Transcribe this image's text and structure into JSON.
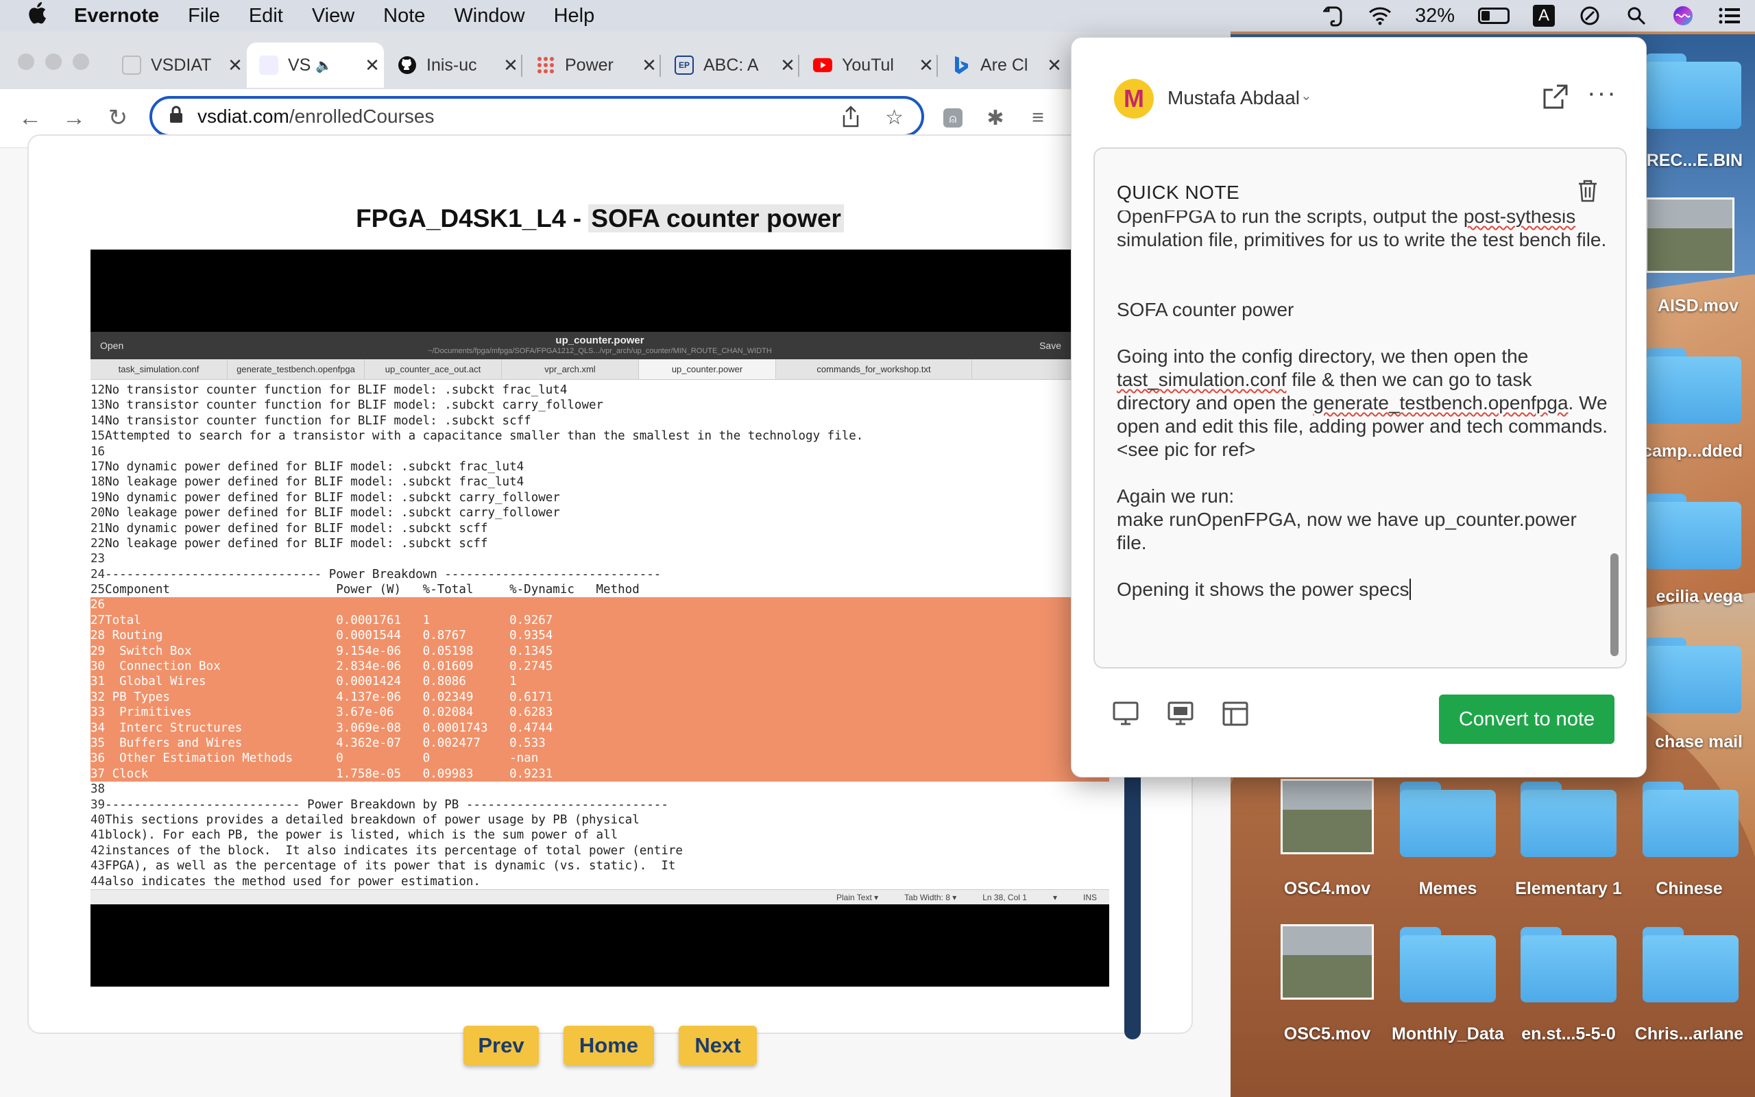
{
  "menubar": {
    "app_name": "Evernote",
    "items": [
      "File",
      "Edit",
      "View",
      "Note",
      "Window",
      "Help"
    ],
    "battery": "32%"
  },
  "browser": {
    "tabs": [
      {
        "title": "VSDIAT",
        "fav": "vsd"
      },
      {
        "title": "VS",
        "fav": "vsd",
        "active": true
      },
      {
        "title": "Inis-uc",
        "fav": "github"
      },
      {
        "title": "Power",
        "fav": "grid"
      },
      {
        "title": "ABC: A",
        "fav": "abc"
      },
      {
        "title": "YouTul",
        "fav": "youtube"
      },
      {
        "title": "Are Cl",
        "fav": "bing"
      }
    ],
    "url_domain": "vsdiat.com",
    "url_path": "/enrolledCourses"
  },
  "lesson": {
    "title_prefix": "FPGA_D4SK1_L4 - ",
    "title_highlight": "SOFA counter power",
    "buttons": {
      "prev": "Prev",
      "home": "Home",
      "next": "Next"
    }
  },
  "gedit": {
    "open": "Open",
    "title": "up_counter.power",
    "subtitle": "~/Documents/fpga/mfpga/SOFA/FPGA1212_QLS.../vpr_arch/up_counter/MIN_ROUTE_CHAN_WIDTH",
    "save": "Save",
    "tabs": [
      "task_simulation.conf",
      "generate_testbench.openfpga",
      "up_counter_ace_out.act",
      "vpr_arch.xml",
      "up_counter.power",
      "commands_for_workshop.txt"
    ],
    "lines": [
      {
        "n": "12",
        "t": "No transistor counter function for BLIF model: .subckt frac_lut4"
      },
      {
        "n": "13",
        "t": "No transistor counter function for BLIF model: .subckt carry_follower"
      },
      {
        "n": "14",
        "t": "No transistor counter function for BLIF model: .subckt scff"
      },
      {
        "n": "15",
        "t": "Attempted to search for a transistor with a capacitance smaller than the smallest in the technology file."
      },
      {
        "n": "16",
        "t": ""
      },
      {
        "n": "17",
        "t": "No dynamic power defined for BLIF model: .subckt frac_lut4"
      },
      {
        "n": "18",
        "t": "No leakage power defined for BLIF model: .subckt frac_lut4"
      },
      {
        "n": "19",
        "t": "No dynamic power defined for BLIF model: .subckt carry_follower"
      },
      {
        "n": "20",
        "t": "No leakage power defined for BLIF model: .subckt carry_follower"
      },
      {
        "n": "21",
        "t": "No dynamic power defined for BLIF model: .subckt scff"
      },
      {
        "n": "22",
        "t": "No leakage power defined for BLIF model: .subckt scff"
      },
      {
        "n": "23",
        "t": ""
      },
      {
        "n": "24",
        "t": "------------------------------ Power Breakdown ------------------------------"
      },
      {
        "n": "25",
        "t": "Component                       Power (W)   %-Total     %-Dynamic   Method"
      },
      {
        "n": "26",
        "t": "",
        "sel": true
      },
      {
        "n": "27",
        "t": "Total                           0.0001761   1           0.9267",
        "sel": true
      },
      {
        "n": "28",
        "t": " Routing                        0.0001544   0.8767      0.9354",
        "sel": true
      },
      {
        "n": "29",
        "t": "  Switch Box                    9.154e-06   0.05198     0.1345",
        "sel": true
      },
      {
        "n": "30",
        "t": "  Connection Box                2.834e-06   0.01609     0.2745",
        "sel": true
      },
      {
        "n": "31",
        "t": "  Global Wires                  0.0001424   0.8086      1",
        "sel": true
      },
      {
        "n": "32",
        "t": " PB Types                       4.137e-06   0.02349     0.6171",
        "sel": true
      },
      {
        "n": "33",
        "t": "  Primitives                    3.67e-06    0.02084     0.6283",
        "sel": true
      },
      {
        "n": "34",
        "t": "  Interc Structures             3.069e-08   0.0001743   0.4744",
        "sel": true
      },
      {
        "n": "35",
        "t": "  Buffers and Wires             4.362e-07   0.002477    0.533",
        "sel": true
      },
      {
        "n": "36",
        "t": "  Other Estimation Methods      0           0           -nan",
        "sel": true
      },
      {
        "n": "37",
        "t": " Clock                          1.758e-05   0.09983     0.9231",
        "sel": true
      },
      {
        "n": "38",
        "t": ""
      },
      {
        "n": "39",
        "t": "--------------------------- Power Breakdown by PB ----------------------------"
      },
      {
        "n": "40",
        "t": "This sections provides a detailed breakdown of power usage by PB (physical"
      },
      {
        "n": "41",
        "t": "block). For each PB, the power is listed, which is the sum power of all"
      },
      {
        "n": "42",
        "t": "instances of the block.  It also indicates its percentage of total power (entire"
      },
      {
        "n": "43",
        "t": "FPGA), as well as the percentage of its power that is dynamic (vs. static).  It"
      },
      {
        "n": "44",
        "t": "also indicates the method used for power estimation."
      }
    ],
    "status": [
      "Plain Text ▾",
      "Tab Width: 8 ▾",
      "Ln 38, Col 1",
      "▾",
      "INS"
    ]
  },
  "desktop": {
    "items": [
      {
        "label": "REC...E.BIN",
        "kind": "partial"
      },
      {
        "label": "AISD.mov",
        "kind": "partial"
      },
      {
        "label": "camp...dded",
        "kind": "partial"
      },
      {
        "label": "ecilia vega",
        "kind": "partial"
      },
      {
        "label": "chase mail",
        "kind": "partial"
      },
      {
        "label": "OSC4.mov",
        "kind": "video"
      },
      {
        "label": "Memes",
        "kind": "folder"
      },
      {
        "label": "Elementary 1",
        "kind": "folder"
      },
      {
        "label": "Chinese",
        "kind": "folder"
      },
      {
        "label": "OSC5.mov",
        "kind": "video"
      },
      {
        "label": "Monthly_Data",
        "kind": "folder"
      },
      {
        "label": "en.st...5-5-0",
        "kind": "folder"
      },
      {
        "label": "Chris...arlane",
        "kind": "folder"
      }
    ]
  },
  "evernote": {
    "user": "Mustafa Abdaal",
    "avatar_letter": "M",
    "note_title": "QUICK NOTE",
    "body": {
      "p1": "OpenFPGA to run the scripts, output the ",
      "p1_sq": "post-sythesis",
      "p1_rest": " simulation file, primitives for us to write the test bench file.",
      "p2": "SOFA counter power",
      "p3a": "Going into the config directory, we then open the ",
      "p3_sq1": "tast_simulation.conf",
      "p3b": " file & then we can go to task directory and open the ",
      "p3_sq2": "generate_testbench.openfpga",
      "p3c": ". We open and edit this file, adding power and tech commands. <see pic for ref>",
      "p4a": "Again we run:",
      "p4b": "make runOpenFPGA, now we have up_counter.power file.",
      "p5": "Opening it shows the power specs"
    },
    "convert_label": "Convert to note",
    "accent": "#1fa64a"
  }
}
